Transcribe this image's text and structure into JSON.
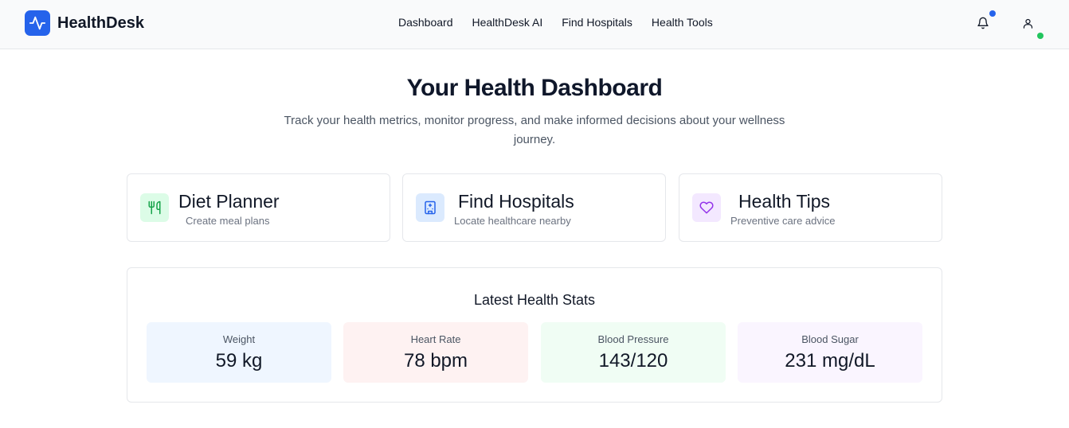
{
  "brand": {
    "name": "HealthDesk",
    "logo_icon": "activity-pulse-icon",
    "accent": "#2563eb"
  },
  "nav": {
    "items": [
      {
        "label": "Dashboard"
      },
      {
        "label": "HealthDesk AI"
      },
      {
        "label": "Find Hospitals"
      },
      {
        "label": "Health Tools"
      }
    ]
  },
  "header_icons": {
    "notifications": {
      "icon": "bell-icon",
      "badge_color": "#2563eb"
    },
    "profile": {
      "icon": "user-icon",
      "status_color": "#22c55e"
    }
  },
  "page": {
    "title": "Your Health Dashboard",
    "subtitle": "Track your health metrics, monitor progress, and make informed decisions about your wellness journey."
  },
  "cards": [
    {
      "title": "Diet Planner",
      "subtitle": "Create meal plans",
      "icon": "utensils-icon",
      "icon_color": "#16a34a",
      "icon_bg": "#dcfce7"
    },
    {
      "title": "Find Hospitals",
      "subtitle": "Locate healthcare nearby",
      "icon": "hospital-building-icon",
      "icon_color": "#2563eb",
      "icon_bg": "#dbeafe"
    },
    {
      "title": "Health Tips",
      "subtitle": "Preventive care advice",
      "icon": "heart-icon",
      "icon_color": "#9333ea",
      "icon_bg": "#f3e8ff"
    }
  ],
  "stats": {
    "title": "Latest Health Stats",
    "items": [
      {
        "label": "Weight",
        "value": "59 kg",
        "bg": "#eff6ff"
      },
      {
        "label": "Heart Rate",
        "value": "78 bpm",
        "bg": "#fef2f2"
      },
      {
        "label": "Blood Pressure",
        "value": "143/120",
        "bg": "#f0fdf4"
      },
      {
        "label": "Blood Sugar",
        "value": "231 mg/dL",
        "bg": "#faf5ff"
      }
    ]
  }
}
